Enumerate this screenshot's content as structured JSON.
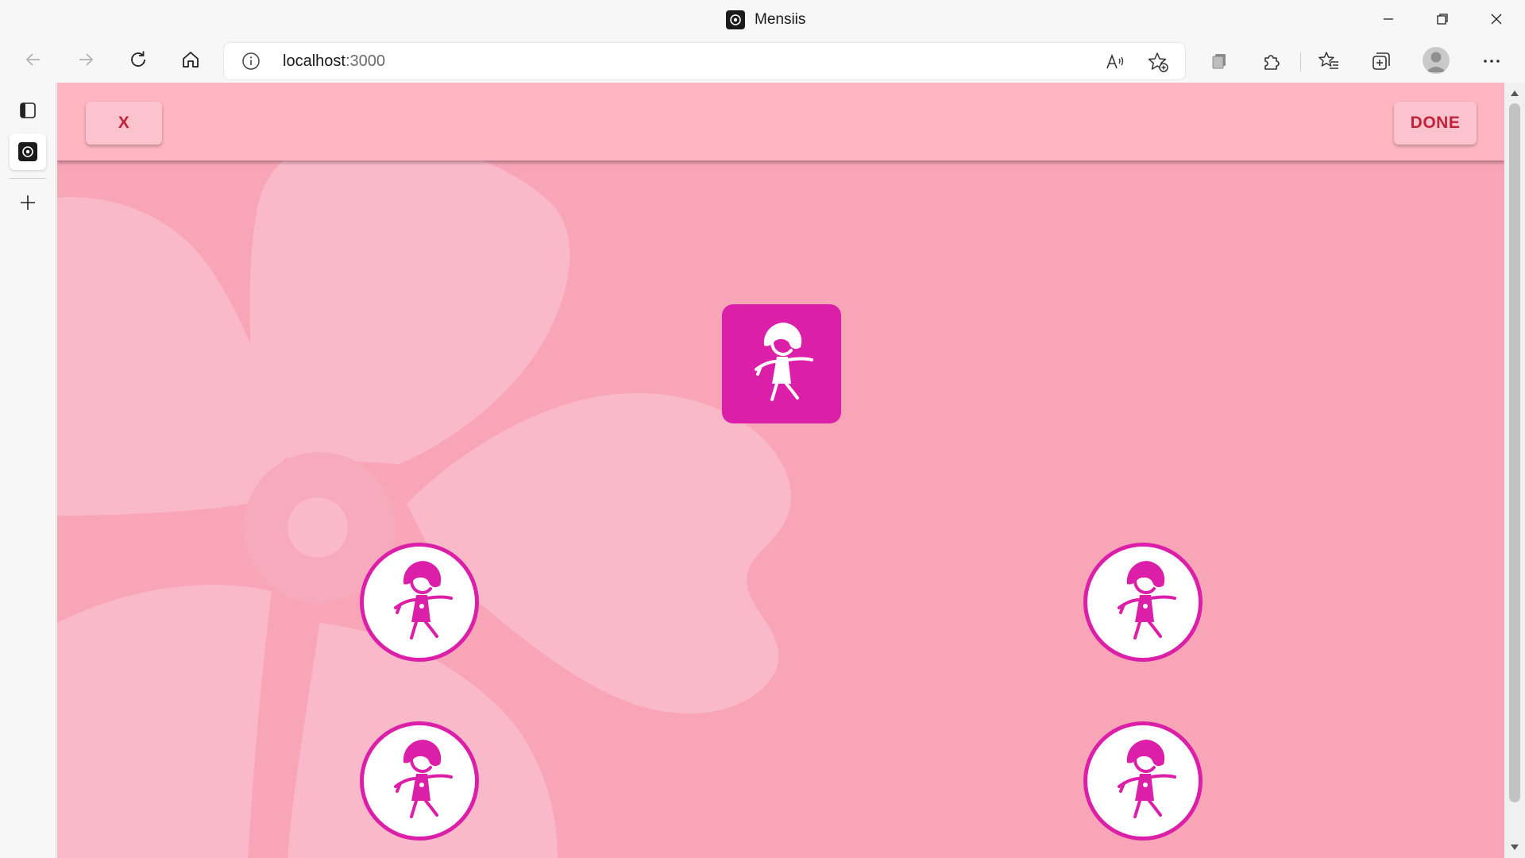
{
  "window": {
    "title": "Mensiis",
    "minimize_glyph": "—",
    "restore_glyph": "❐",
    "close_glyph": "✕"
  },
  "toolbar": {
    "url_host": "localhost",
    "url_port": ":3000",
    "icons": [
      "back-icon",
      "forward-icon",
      "refresh-icon",
      "home-icon",
      "site-info-icon",
      "read-aloud-icon",
      "add-favorite-icon",
      "collections-icon",
      "extensions-icon",
      "favorites-icon",
      "add-tab-group-icon",
      "profile-icon",
      "more-icon"
    ]
  },
  "sidebar": {
    "icons": [
      "tab-actions-icon",
      "active-tab-favicon",
      "new-tab-icon"
    ]
  },
  "app": {
    "header": {
      "close_label": "X",
      "done_label": "DONE"
    },
    "target": {
      "icon": "girl-figure-icon"
    },
    "choices": [
      {
        "icon": "girl-figure-icon"
      },
      {
        "icon": "girl-figure-icon"
      },
      {
        "icon": "girl-figure-icon"
      },
      {
        "icon": "girl-figure-icon"
      }
    ],
    "background": "flower-decoration"
  },
  "colors": {
    "page_background": "#f8a5b8",
    "flower_petal": "#fab9c8",
    "header_background": "#ffb6c1",
    "button_background": "#fbc3cd",
    "button_text": "#c0233a",
    "accent_magenta": "#dc1fa9",
    "choice_fill": "#ffffff"
  }
}
